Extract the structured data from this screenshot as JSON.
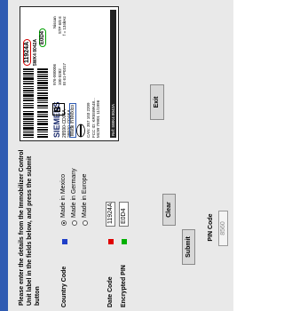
{
  "instructions": "Please enter the details from the Immobilizer Control Unit label in the fields below, and press the submit button",
  "country_code": {
    "label": "Country Code",
    "color": "#1f3fc8",
    "options": [
      "Made in Mexico",
      "Made in Germany",
      "Made in Europe"
    ],
    "selected": "Made in Mexico"
  },
  "date_code": {
    "label": "Date Code",
    "color": "#e00000",
    "value": "11924A"
  },
  "encrypted_pin": {
    "label": "Encrypted PIN",
    "color": "#00b000",
    "value": "E0D4"
  },
  "buttons": {
    "submit": "Submit",
    "clear": "Clear",
    "exit": "Exit"
  },
  "pin_code": {
    "label": "PIN Code",
    "value": "8560"
  },
  "ecu_label": {
    "id_red": "11924A",
    "id_green": "E0D4",
    "part_no": "5WK4 8042A",
    "brand": "SIEMENS",
    "model_line1": "28590-CD05A",
    "model_line2": "28590-CD05A",
    "made_in": "Made in Mexico",
    "box_letter": "B",
    "can_line": "CAN: 357 103 2209",
    "fcc_line": "FCC ID: KR55WK48...",
    "mcw_line": "MCW 79901 11/1996",
    "right_line1": "976-000006",
    "right_line2": "100 0282",
    "right_line3": "EI 61-P0317",
    "nissan_line1": "Nissan",
    "nissan_line2": "STP 6/6 6",
    "nissan_line3": "f = 134kHz",
    "footer": "Ref: 5WK4 8042A"
  }
}
